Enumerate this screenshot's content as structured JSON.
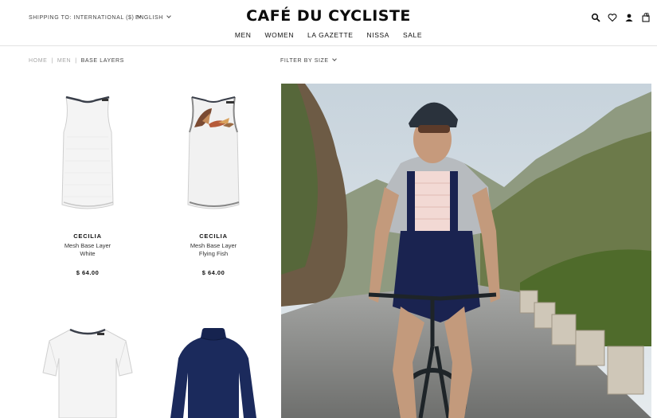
{
  "header": {
    "shipping": "SHIPPING TO: INTERNATIONAL ($)",
    "language": "ENGLISH",
    "logo": "CAFÉ DU CYCLISTE",
    "cart_count": "0"
  },
  "nav": {
    "items": [
      "MEN",
      "WOMEN",
      "LA GAZETTE",
      "NISSA",
      "SALE"
    ]
  },
  "breadcrumb": {
    "items": [
      "HOME",
      "MEN",
      "BASE LAYERS"
    ]
  },
  "filter": {
    "label": "FILTER BY SIZE"
  },
  "products": [
    {
      "name": "CECILIA",
      "desc_line1": "Mesh Base Layer",
      "desc_line2": "White",
      "price": "$ 64.00"
    },
    {
      "name": "CECILIA",
      "desc_line1": "Mesh Base Layer",
      "desc_line2": "Flying Fish",
      "price": "$ 64.00"
    }
  ],
  "colors": {
    "navy": "#1b2a5c",
    "white_garment": "#f3f3f3",
    "trim": "#3a3f4a"
  },
  "icons": [
    "search-icon",
    "heart-icon",
    "user-icon",
    "bag-icon"
  ]
}
